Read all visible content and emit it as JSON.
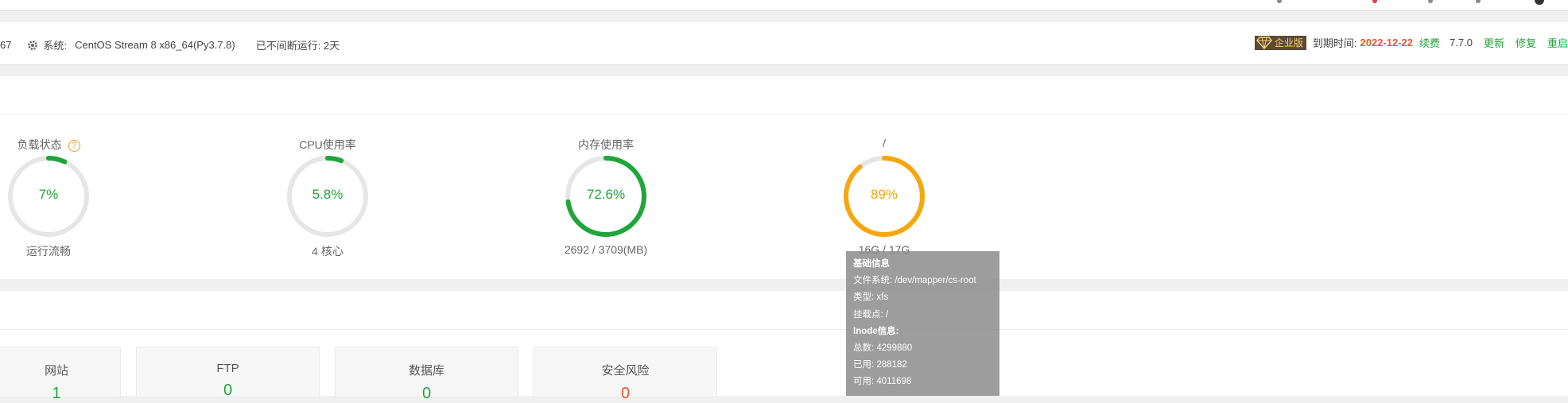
{
  "info": {
    "left_fragment": "67",
    "system_label": "系统:",
    "system_value": "CentOS Stream 8 x86_64(Py3.7.8)",
    "uptime": "已不间断运行: 2天",
    "edition": "企业版",
    "expire_label": "到期时间:",
    "expire_date": "2022-12-22",
    "renew": "续费",
    "version": "7.7.0",
    "update": "更新",
    "repair": "修复",
    "restart": "重启"
  },
  "gauges": [
    {
      "title": "负载状态",
      "value": "7%",
      "percent": 7,
      "sub": "运行流畅",
      "color": "#20a53a"
    },
    {
      "title": "CPU使用率",
      "value": "5.8%",
      "percent": 5.8,
      "sub": "4 核心",
      "color": "#20a53a"
    },
    {
      "title": "内存使用率",
      "value": "72.6%",
      "percent": 72.6,
      "sub": "2692 / 3709(MB)",
      "color": "#20a53a"
    },
    {
      "title": "/",
      "value": "89%",
      "percent": 89,
      "sub": "16G / 17G",
      "color": "#f7a60d"
    }
  ],
  "cards": [
    {
      "label": "网站",
      "value": "1",
      "color": "#20a53a"
    },
    {
      "label": "FTP",
      "value": "0",
      "color": "#20a53a"
    },
    {
      "label": "数据库",
      "value": "0",
      "color": "#20a53a"
    },
    {
      "label": "安全风险",
      "value": "0",
      "color": "#e8562f"
    }
  ],
  "tooltip": {
    "base_info": "基础信息",
    "filesystem": "文件系统: /dev/mapper/cs-root",
    "type": "类型: xfs",
    "mount": "挂载点: /",
    "inode_info": "Inode信息:",
    "total": "总数: 4299880",
    "used": "已用: 288182",
    "free": "可用: 4011698"
  },
  "colors": {
    "green": "#20a53a",
    "orange": "#f7a60d",
    "ring_bg": "#e6e6e6",
    "red": "#e8562f"
  }
}
